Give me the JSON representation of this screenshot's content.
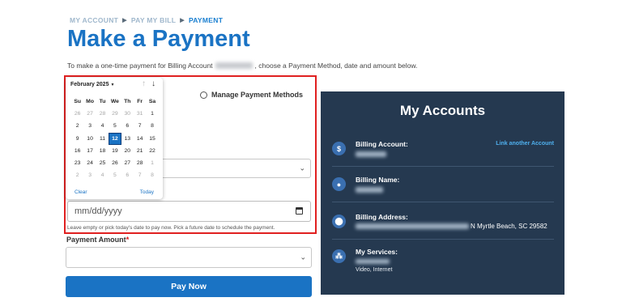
{
  "breadcrumb": [
    "MY ACCOUNT",
    "PAY MY BILL",
    "PAYMENT"
  ],
  "page": {
    "title": "Make a Payment",
    "subtitle_before": "To make a one-time payment for Billing Account",
    "subtitle_after": ", choose a Payment Method, date and amount below."
  },
  "payment_method": {
    "manage_label": "Manage Payment Methods"
  },
  "date_field": {
    "placeholder": "mm/dd/yyyy",
    "hint": "Leave empty or pick today's date to pay now. Pick a future date to schedule the payment."
  },
  "calendar": {
    "month_label": "February 2025",
    "weekdays": [
      "Su",
      "Mo",
      "Tu",
      "We",
      "Th",
      "Fr",
      "Sa"
    ],
    "weeks": [
      [
        "26",
        "27",
        "28",
        "29",
        "30",
        "31",
        "1"
      ],
      [
        "2",
        "3",
        "4",
        "5",
        "6",
        "7",
        "8"
      ],
      [
        "9",
        "10",
        "11",
        "12",
        "13",
        "14",
        "15"
      ],
      [
        "16",
        "17",
        "18",
        "19",
        "20",
        "21",
        "22"
      ],
      [
        "23",
        "24",
        "25",
        "26",
        "27",
        "28",
        "1"
      ],
      [
        "2",
        "3",
        "4",
        "5",
        "6",
        "7",
        "8"
      ]
    ],
    "selected_day": "12",
    "clear_label": "Clear",
    "today_label": "Today"
  },
  "amount": {
    "label": "Payment Amount",
    "required_mark": "*"
  },
  "pay_button": "Pay Now",
  "accounts": {
    "title": "My Accounts",
    "link_label": "Link another Account",
    "billing_account_label": "Billing Account:",
    "billing_name_label": "Billing Name:",
    "billing_address_label": "Billing Address:",
    "billing_address_visible": "N Myrtle Beach, SC 29582",
    "services_label": "My Services:",
    "services_value": "Video, Internet"
  },
  "colors": {
    "accent": "#1a73c4",
    "panel": "#253950",
    "highlight": "#e02020"
  }
}
